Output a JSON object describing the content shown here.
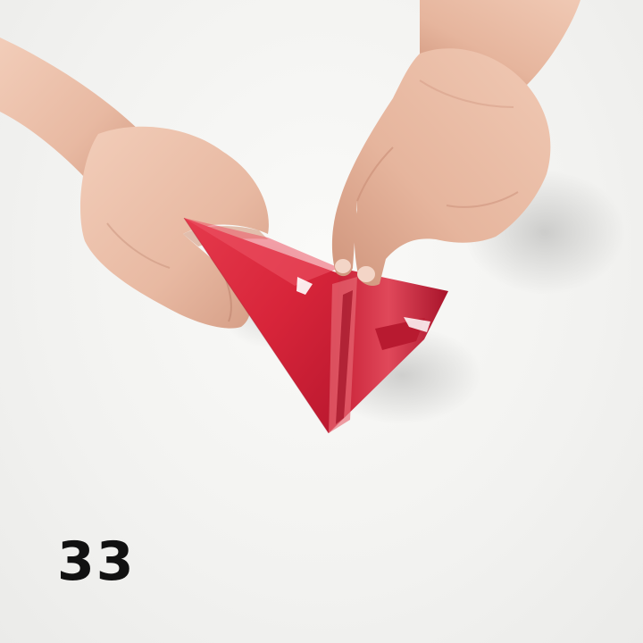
{
  "step": {
    "number": "33"
  },
  "colors": {
    "background": "#f3f3f1",
    "paper_red": "#d8253a",
    "paper_dark_red": "#a8132a",
    "skin": "#ecc3ae",
    "skin_shadow": "#c9907a",
    "number_text": "#111111"
  }
}
